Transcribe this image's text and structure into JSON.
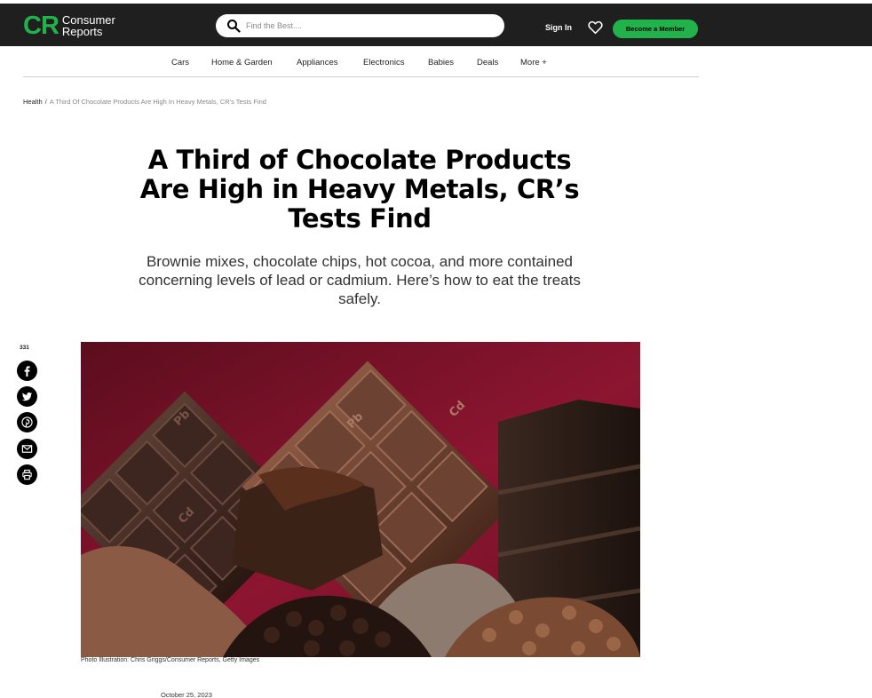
{
  "header": {
    "logo_mark": "CR",
    "logo_line1": "Consumer",
    "logo_line2": "Reports",
    "search_placeholder": "Find the Best....",
    "sign_in": "Sign In",
    "member_button": "Become a Member"
  },
  "nav": {
    "items": [
      "Cars",
      "Home & Garden",
      "Appliances",
      "Electronics",
      "Babies",
      "Deals",
      "More +"
    ]
  },
  "breadcrumb": {
    "parent": "Health",
    "separator": "/",
    "current": "A Third Of Chocolate Products Are High In Heavy Metals, CR's Tests Find"
  },
  "article": {
    "headline": "A Third of Chocolate Products Are High in Heavy Metals, CR’s Tests Find",
    "dek": "Brownie mixes, chocolate chips, hot cocoa, and more contained concerning levels of lead or cadmium. Here’s how to eat the treats safely.",
    "image_caption": "Photo Illustration: Chris Griggs/Consumer Reports, Getty Images",
    "date": "October 25, 2023",
    "bar_markings": [
      "Pb",
      "Pb",
      "Cd",
      "Cd"
    ]
  },
  "share": {
    "count": "331",
    "icons": [
      "facebook-icon",
      "twitter-icon",
      "pinterest-icon",
      "email-icon",
      "print-icon"
    ]
  },
  "colors": {
    "header_bg": "#1f1f1f",
    "brand_green": "#22b24c",
    "hero_bg": "#8c1530"
  }
}
